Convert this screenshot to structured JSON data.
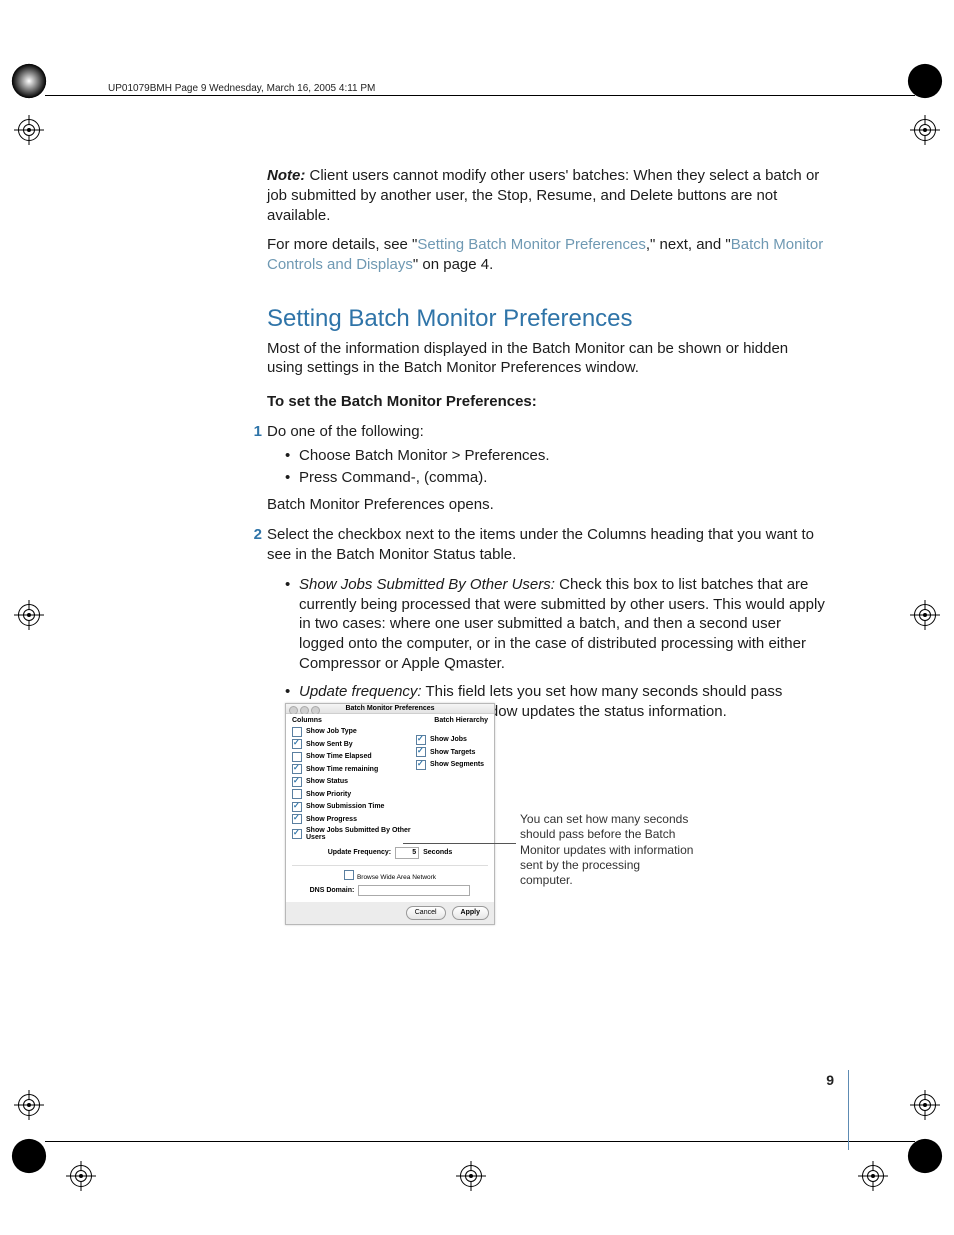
{
  "header": "UP01079BMH  Page 9  Wednesday, March 16, 2005  4:11 PM",
  "page_number": "9",
  "note_label": "Note:",
  "note_body": "  Client users cannot modify other users' batches:  When they select a batch or job submitted by another user, the Stop, Resume, and Delete buttons are not available.",
  "xref_pre": "For more details, see \"",
  "xref_link1": "Setting Batch Monitor Preferences",
  "xref_mid": ",\" next, and \"",
  "xref_link2": "Batch Monitor Controls and Displays",
  "xref_post": "\" on page 4.",
  "h2": "Setting Batch Monitor Preferences",
  "intro": "Most of the information displayed in the Batch Monitor can be shown or hidden using settings in the Batch Monitor Preferences window.",
  "toset": "To set the Batch Monitor Preferences:",
  "step1": {
    "num": "1",
    "text": "Do one of the following:",
    "b1": "Choose Batch Monitor > Preferences.",
    "b2": "Press Command-, (comma).",
    "after": "Batch Monitor Preferences opens."
  },
  "step2": {
    "num": "2",
    "text": "Select the checkbox next to the items under the Columns heading that you want to see in the Batch Monitor Status table.",
    "b1_label": "Show Jobs Submitted By Other Users:",
    "b1_body": "  Check this box to list batches that are currently being processed that were submitted by other users. This would apply in two cases:  where one user submitted a batch, and then a second user logged onto the computer, or in the case of distributed processing with either Compressor or Apple Qmaster.",
    "b2_label": "Update frequency:",
    "b2_body": "  This field lets you set how many seconds should pass before the Batch Monitor window updates the status information."
  },
  "dialog": {
    "title": "Batch Monitor Preferences",
    "columns_header": "Columns",
    "hierarchy_header": "Batch Hierarchy",
    "left": [
      {
        "label": "Show Job Type",
        "checked": false
      },
      {
        "label": "Show Sent By",
        "checked": true
      },
      {
        "label": "Show Time Elapsed",
        "checked": false
      },
      {
        "label": "Show Time remaining",
        "checked": true
      },
      {
        "label": "Show Status",
        "checked": true
      },
      {
        "label": "Show Priority",
        "checked": false
      },
      {
        "label": "Show Submission Time",
        "checked": true
      },
      {
        "label": "Show Progress",
        "checked": true
      },
      {
        "label": "Show Jobs Submitted By Other Users",
        "checked": true
      }
    ],
    "right": [
      {
        "label": "Show Jobs",
        "checked": true
      },
      {
        "label": "Show Targets",
        "checked": true
      },
      {
        "label": "Show Segments",
        "checked": true
      }
    ],
    "freq_label": "Update Frequency:",
    "freq_value": "5",
    "freq_unit": "Seconds",
    "wan": "Browse Wide Area Network",
    "dns_label": "DNS Domain:",
    "cancel": "Cancel",
    "apply": "Apply"
  },
  "annotation": "You can set how many seconds should pass before the Batch Monitor updates with information sent by the processing computer."
}
